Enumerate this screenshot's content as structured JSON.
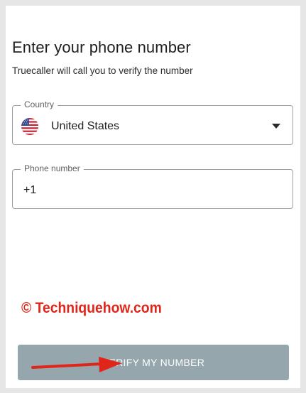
{
  "page": {
    "title": "Enter your phone number",
    "subtitle": "Truecaller will call you to verify the number"
  },
  "country_field": {
    "label": "Country",
    "value": "United States",
    "flag_icon": "us-flag-icon",
    "dropdown_icon": "caret-down-icon"
  },
  "phone_field": {
    "label": "Phone number",
    "value": "+1"
  },
  "watermark": {
    "text": "© Techniquehow.com",
    "color": "#e0261b"
  },
  "verify_button": {
    "label": "VERIFY MY NUMBER",
    "color": "#95a6ac"
  },
  "annotation": {
    "arrow_icon": "red-arrow-icon",
    "color": "#e0261b"
  }
}
